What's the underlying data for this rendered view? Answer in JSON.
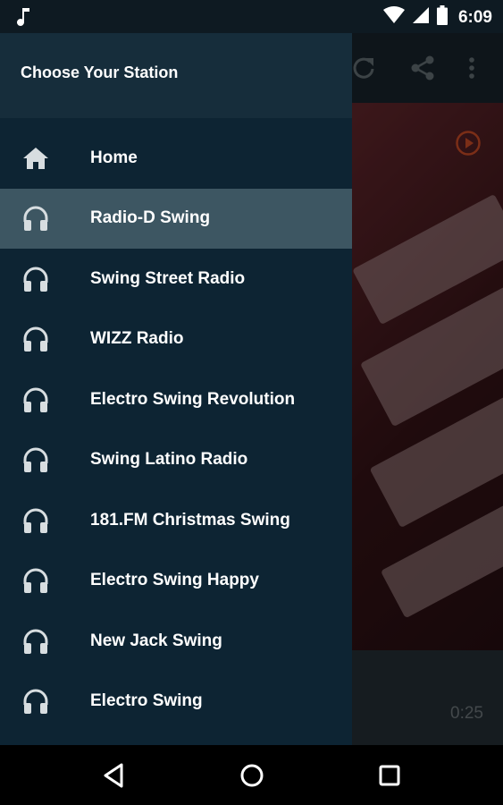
{
  "status_bar": {
    "time": "6:09",
    "icons": [
      "music-note-icon",
      "wifi-icon",
      "cell-signal-icon",
      "battery-icon"
    ]
  },
  "background": {
    "toolbar_icons": [
      "refresh-icon",
      "share-icon",
      "more-vert-icon"
    ],
    "elapsed_time": "0:25"
  },
  "drawer": {
    "title": "Choose Your Station",
    "items": [
      {
        "label": "Home",
        "icon": "home-icon"
      },
      {
        "label": "Radio-D Swing",
        "icon": "headphones-icon",
        "selected": true
      },
      {
        "label": "Swing Street Radio",
        "icon": "headphones-icon"
      },
      {
        "label": "WIZZ Radio",
        "icon": "headphones-icon"
      },
      {
        "label": "Electro Swing Revolution",
        "icon": "headphones-icon"
      },
      {
        "label": "Swing Latino Radio",
        "icon": "headphones-icon"
      },
      {
        "label": "181.FM Christmas Swing",
        "icon": "headphones-icon"
      },
      {
        "label": "Electro Swing Happy",
        "icon": "headphones-icon"
      },
      {
        "label": "New Jack Swing",
        "icon": "headphones-icon"
      },
      {
        "label": "Electro Swing",
        "icon": "headphones-icon"
      }
    ]
  },
  "nav_bar": {
    "buttons": [
      "back-icon",
      "home-circle-icon",
      "recents-icon"
    ]
  },
  "colors": {
    "drawer_bg": "#0d2433",
    "drawer_header_bg": "#162d3b",
    "selected_bg": "#3d5662",
    "accent": "#e0542a"
  }
}
